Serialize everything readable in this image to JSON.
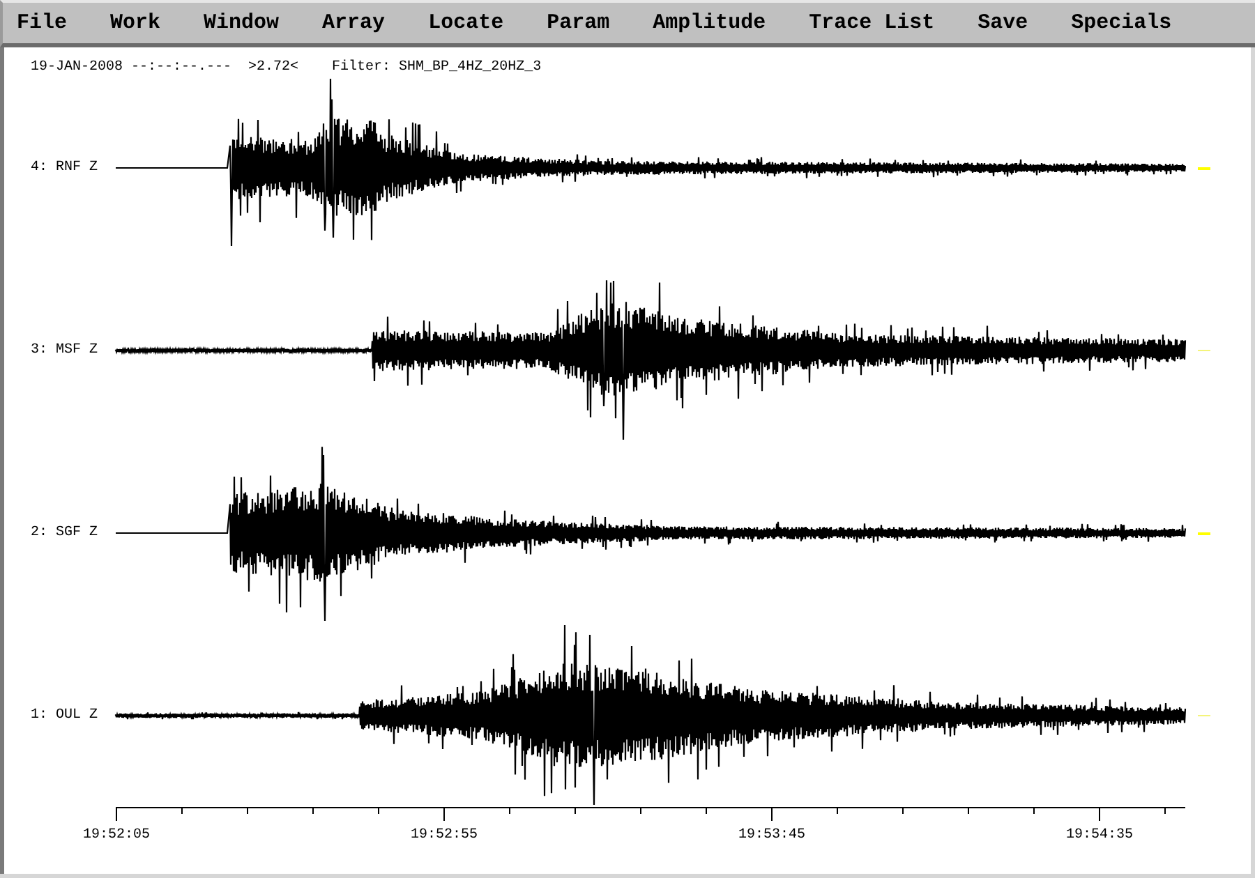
{
  "menu": [
    "File",
    "Work",
    "Window",
    "Array",
    "Locate",
    "Param",
    "Amplitude",
    "Trace List",
    "Save",
    "Specials"
  ],
  "header": {
    "time": "19-JAN-2008 --:--:--.---",
    "value": ">2.72<",
    "filter": "Filter: SHM_BP_4HZ_20HZ_3"
  },
  "traces": [
    {
      "label": "4: RNF Z",
      "highlighted": true
    },
    {
      "label": "3: MSF Z",
      "highlighted": false
    },
    {
      "label": "2: SGF Z",
      "highlighted": true
    },
    {
      "label": "1: OUL Z",
      "highlighted": false
    }
  ],
  "time_axis": {
    "labels": [
      "19:52:05",
      "19:52:55",
      "19:53:45",
      "19:54:35"
    ]
  }
}
